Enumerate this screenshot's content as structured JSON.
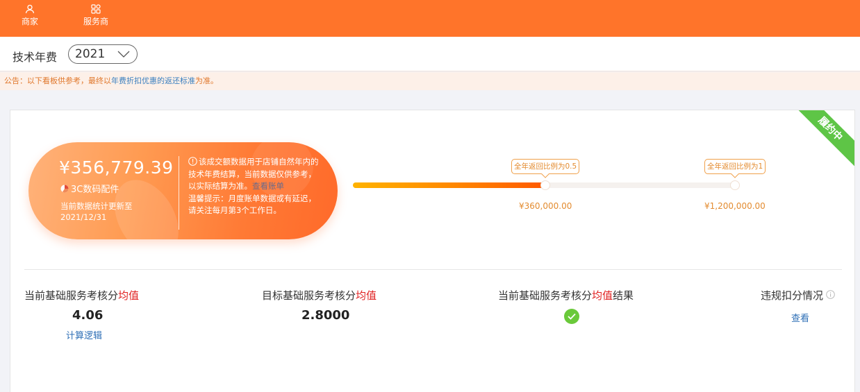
{
  "nav": {
    "merchant": {
      "label": "商家",
      "icon": "user-icon"
    },
    "provider": {
      "label": "服务商",
      "icon": "grid-icon"
    }
  },
  "header": {
    "title": "技术年费",
    "year_select": {
      "value": "2021"
    }
  },
  "notice": {
    "prefix": "公告：以下看板供参考，最终以",
    "highlight": "年费折扣优惠的返还标准",
    "suffix": "为准。"
  },
  "status_ribbon": "履约中",
  "summary": {
    "amount": "¥356,779.39",
    "category": "3C数码配件",
    "update_text": "当前数据统计更新至2021/12/31",
    "description": "该成交额数据用于店铺自然年内的技术年费结算，当前数据仅供参考，以实际结算为准。",
    "view_bill": "查看账单",
    "reminder": "温馨提示：月度账单数据或有延迟，请关注每月第3个工作日。"
  },
  "progress": {
    "current_value": 356779.39,
    "max_value": 1200000,
    "milestones": [
      {
        "label": "全年返回比例为0.5",
        "amount": "¥360,000.00",
        "value": 360000
      },
      {
        "label": "全年返回比例为1",
        "amount": "¥1,200,000.00",
        "value": 1200000
      }
    ]
  },
  "metrics": [
    {
      "label_prefix": "当前基础服务考核分",
      "label_red": "均值",
      "label_suffix": "",
      "value": "4.06",
      "link": "计算逻辑"
    },
    {
      "label_prefix": "目标基础服务考核分",
      "label_red": "均值",
      "label_suffix": "",
      "value": "2.8000"
    },
    {
      "label_prefix": "当前基础服务考核分",
      "label_red": "均值",
      "label_suffix": "结果",
      "status": "pass"
    },
    {
      "label_prefix": "违规扣分情况",
      "label_red": "",
      "label_suffix": "",
      "link": "查看"
    }
  ],
  "colors": {
    "brand": "#ff742a",
    "ribbon": "#5ec546",
    "success": "#6ac93a",
    "link": "#2e6fb6",
    "highlight_red": "#e02020",
    "milestone": "#e38b2f"
  }
}
